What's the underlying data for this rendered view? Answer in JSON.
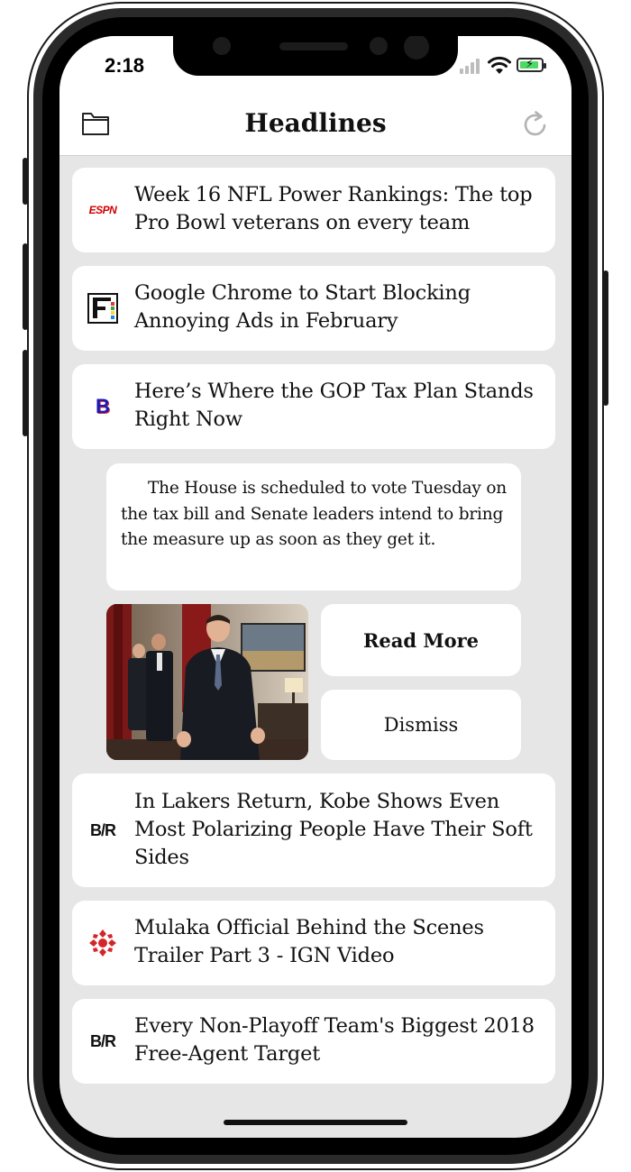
{
  "status_bar": {
    "time": "2:18"
  },
  "nav": {
    "title": "Headlines",
    "left_icon": "folder-icon",
    "right_icon": "refresh-icon"
  },
  "headlines": [
    {
      "source_logo": "ESPN",
      "logo_color": "#d00000",
      "title": "Week 16 NFL Power Rankings: The top Pro Bowl veterans on every team"
    },
    {
      "source_logo": "F",
      "title": "Google Chrome to Start Blocking Annoying Ads in February"
    },
    {
      "source_logo": "B",
      "logo_color": "#1a1ab8",
      "title": "Here’s Where the GOP Tax Plan Stands Right Now"
    },
    {
      "source_logo": "B/R",
      "title": "In Lakers Return, Kobe Shows Even Most Polarizing People Have Their Soft Sides"
    },
    {
      "source_logo": "ign-logo",
      "logo_color": "#d3262a",
      "title": "Mulaka Official Behind the Scenes Trailer Part 3 - IGN Video"
    },
    {
      "source_logo": "B/R",
      "title": "Every Non-Playoff Team's Biggest 2018 Free-Agent Target"
    }
  ],
  "expanded": {
    "summary": "The House is scheduled to vote Tuesday on the tax bill and Senate leaders intend to bring the measure up as soon as they get it.",
    "read_more_label": "Read More",
    "dismiss_label": "Dismiss"
  },
  "colors": {
    "screen_bg": "#e6e6e6",
    "card_bg": "#ffffff",
    "text": "#111111",
    "battery": "#4cd964"
  }
}
